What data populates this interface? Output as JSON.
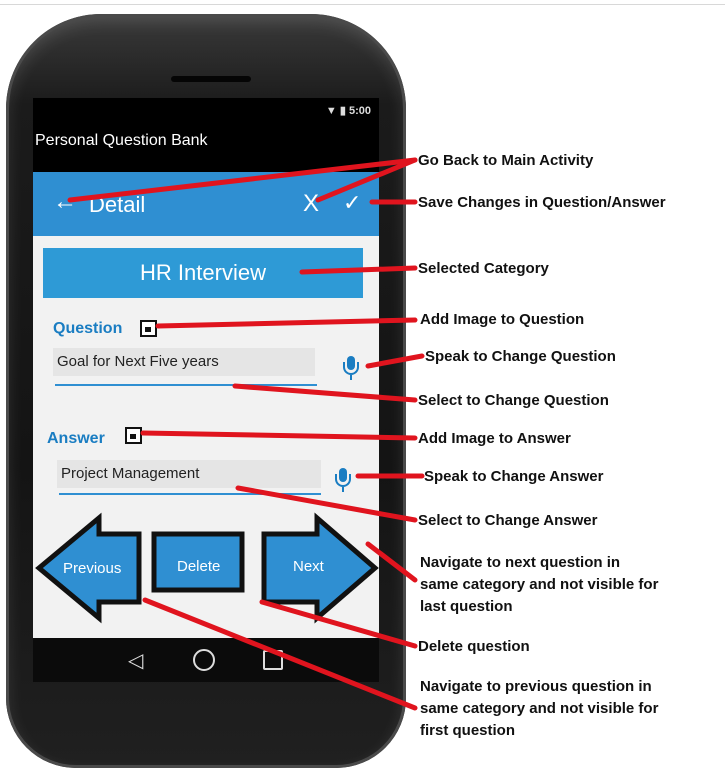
{
  "status": {
    "time": "5:00",
    "signal_icon": "wifi-icon",
    "battery_icon": "battery-icon"
  },
  "app": {
    "title": "Personal Question Bank"
  },
  "actionbar": {
    "back_icon": "←",
    "title": "Detail",
    "close_label": "X",
    "save_icon": "✓"
  },
  "category": {
    "label": "HR Interview"
  },
  "question": {
    "label": "Question",
    "value": "Goal for Next Five years",
    "image_icon": "image-icon",
    "mic_icon": "mic-icon"
  },
  "answer": {
    "label": "Answer",
    "value": "Project Management",
    "image_icon": "image-icon",
    "mic_icon": "mic-icon"
  },
  "buttons": {
    "previous": "Previous",
    "delete": "Delete",
    "next": "Next"
  },
  "annotations": {
    "go_back": "Go Back to Main Activity",
    "save": "Save Changes in Question/Answer",
    "category": "Selected Category",
    "add_image_question": "Add Image to Question",
    "speak_question": "Speak to Change Question",
    "select_question": "Select to Change Question",
    "add_image_answer": "Add Image to Answer",
    "speak_answer": "Speak to Change Answer",
    "select_answer": "Select to Change Answer",
    "next_line1": "Navigate to next question in",
    "next_line2": "same category and not visible for",
    "next_line3": "last question",
    "delete": "Delete question",
    "prev_line1": "Navigate to previous question in",
    "prev_line2": "same category and not visible for",
    "prev_line3": "first question"
  },
  "colors": {
    "accent": "#2f8fd2",
    "category": "#2e9ad6",
    "annotation_line": "#e0141e",
    "label": "#1a7dc2"
  }
}
